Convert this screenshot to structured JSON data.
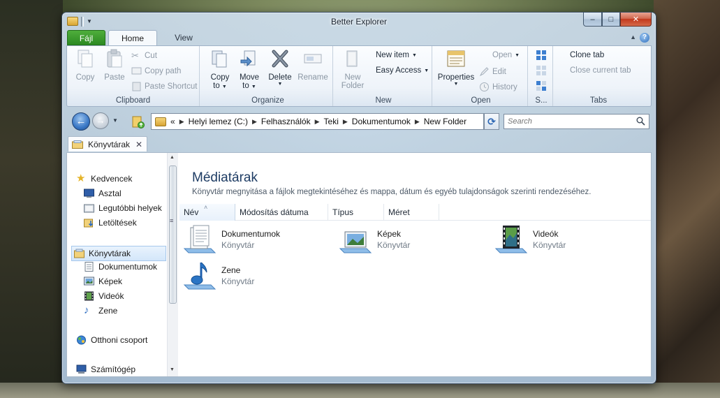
{
  "window": {
    "title": "Better Explorer",
    "controls": {
      "minimize": "–",
      "maximize": "□",
      "close": "✕"
    }
  },
  "ribbon_tabs": {
    "file": "Fájl",
    "home": "Home",
    "view": "View",
    "help": "?"
  },
  "ribbon": {
    "clipboard": {
      "label": "Clipboard",
      "copy": "Copy",
      "paste": "Paste",
      "cut": "Cut",
      "copy_path": "Copy path",
      "paste_shortcut": "Paste Shortcut"
    },
    "organize": {
      "label": "Organize",
      "copy_to": "Copy",
      "copy_to_2": "to",
      "move_to": "Move",
      "move_to_2": "to",
      "delete": "Delete",
      "rename": "Rename"
    },
    "new": {
      "label": "New",
      "new_folder": "New",
      "new_folder_2": "Folder",
      "new_item": "New item",
      "easy_access": "Easy Access"
    },
    "open": {
      "label": "Open",
      "properties": "Properties",
      "open": "Open",
      "edit": "Edit",
      "history": "History"
    },
    "select": {
      "label": "S..."
    },
    "tabs": {
      "label": "Tabs",
      "clone_tab": "Clone tab",
      "close_current_tab": "Close current tab"
    }
  },
  "address": {
    "prefix": "«",
    "crumbs": [
      "Helyi lemez (C:)",
      "Felhasználók",
      "Teki",
      "Dokumentumok",
      "New Folder"
    ],
    "search_placeholder": "Search"
  },
  "file_tab": {
    "label": "Könyvtárak"
  },
  "navpane": {
    "favorites": "Kedvencek",
    "desktop": "Asztal",
    "recent": "Legutóbbi helyek",
    "downloads": "Letöltések",
    "libraries": "Könyvtárak",
    "documents": "Dokumentumok",
    "pictures": "Képek",
    "videos": "Videók",
    "music": "Zene",
    "homegroup": "Otthoni csoport",
    "computer": "Számítógép"
  },
  "main": {
    "title": "Médiatárak",
    "description": "Könyvtár megnyitása a fájlok megtekintéséhez és mappa, dátum és egyéb tulajdonságok szerinti rendezéséhez.",
    "columns": [
      "Név",
      "Módosítás dátuma",
      "Típus",
      "Méret"
    ],
    "libraries": [
      {
        "name": "Dokumentumok",
        "type": "Könyvtár"
      },
      {
        "name": "Képek",
        "type": "Könyvtár"
      },
      {
        "name": "Videók",
        "type": "Könyvtár"
      },
      {
        "name": "Zene",
        "type": "Könyvtár"
      }
    ]
  },
  "colors": {
    "accent": "#2f6fbd",
    "file_tab": "#2c8a22",
    "title": "#1e3c64"
  }
}
